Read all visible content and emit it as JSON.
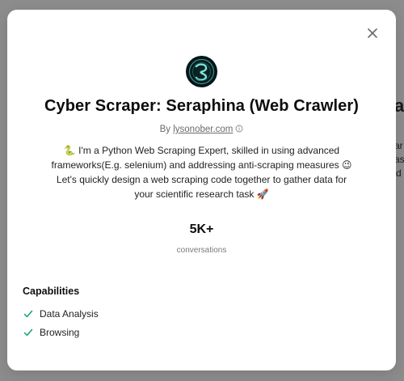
{
  "background": {
    "fragment_big": "av",
    "fragment_1": "ar",
    "fragment_2": "as",
    "fragment_3": "d"
  },
  "modal": {
    "title": "Cyber Scraper: Seraphina (Web Crawler)",
    "by_prefix": "By ",
    "author": "lysonober.com",
    "description_line1_text": " I'm a Python Web Scraping Expert, skilled in using advanced",
    "description_line1_emoji": "🐍",
    "description_line2_text": "frameworks(E.g. selenium) and addressing anti-scraping measures ",
    "description_line2_emoji": "😉",
    "description_line3": "Let's quickly design a web scraping code together to gather data for",
    "description_line4_text": "your scientific research task ",
    "description_line4_emoji": "🚀",
    "stat_value": "5K+",
    "stat_label": "conversations",
    "capabilities_heading": "Capabilities",
    "capabilities": [
      "Data Analysis",
      "Browsing"
    ]
  },
  "colors": {
    "accent_check": "#10a37f",
    "overlay": "#8a8a8a"
  },
  "icons": {
    "close": "close-icon",
    "info": "info-icon",
    "check": "check-icon"
  }
}
